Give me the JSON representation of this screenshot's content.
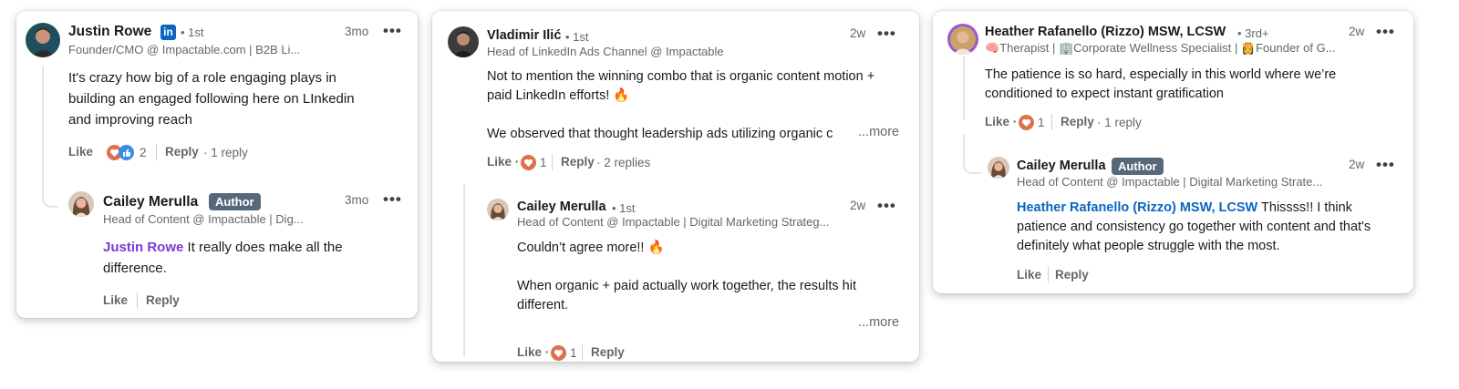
{
  "cards": [
    {
      "comment": {
        "name": "Justin Rowe",
        "degree": "• 1st",
        "headline": "Founder/CMO @ Impactable.com | B2B Li...",
        "time": "3mo",
        "body": [
          "It's crazy how big of a role engaging plays in",
          "building an engaged following here on LInkedin",
          "and improving reach"
        ],
        "like": "Like",
        "reaction_count": "2",
        "reply": "Reply",
        "replies": "· 1 reply"
      },
      "reply": {
        "name": "Cailey Merulla",
        "badge": "Author",
        "headline": "Head of Content @ Impactable | Dig...",
        "time": "3mo",
        "mention": "Justin Rowe",
        "body_after_mention": " It really does make all the",
        "body_line2": "difference.",
        "like": "Like",
        "reply": "Reply"
      }
    },
    {
      "comment": {
        "name": "Vladimir Ilić",
        "degree": "• 1st",
        "headline": "Head of LinkedIn Ads Channel @ Impactable",
        "time": "2w",
        "body": [
          "Not to mention the winning combo that is organic content motion +",
          "paid LinkedIn efforts! 🔥",
          "We observed that thought leadership ads utilizing organic c"
        ],
        "see_more": "...more",
        "like": "Like ·",
        "reaction_count": "1",
        "reply": "Reply",
        "replies": "· 2 replies"
      },
      "reply": {
        "name": "Cailey Merulla",
        "degree": "• 1st",
        "headline": "Head of Content @ Impactable | Digital Marketing Strateg...",
        "time": "2w",
        "body": [
          "Couldn’t agree more!! 🔥",
          "When organic + paid actually work together, the results hit",
          "different."
        ],
        "see_more": "...more",
        "like": "Like ·",
        "reaction_count": "1",
        "reply": "Reply"
      }
    },
    {
      "comment": {
        "name": "Heather Rafanello (Rizzo) MSW, LCSW",
        "degree": "• 3rd+",
        "headline": "🧠Therapist | 🏢Corporate Wellness Specialist | 👸Founder of G...",
        "time": "2w",
        "body": [
          "The patience is so hard, especially in this world where we’re",
          "conditioned to expect instant gratification"
        ],
        "like": "Like ·",
        "reaction_count": "1",
        "reply": "Reply",
        "replies": "· 1 reply"
      },
      "reply": {
        "name": "Cailey Merulla",
        "badge": "Author",
        "headline": "Head of Content @ Impactable | Digital Marketing Strate...",
        "time": "2w",
        "mention": "Heather Rafanello (Rizzo) MSW, LCSW",
        "body_after_mention": " Thissss!! I think",
        "body_line2": "patience and consistency go together with content and that's",
        "body_line3": "definitely what people struggle with the most.",
        "like": "Like",
        "reply": "Reply"
      }
    }
  ],
  "icons": {
    "linkedin_badge": "in",
    "more_menu": "•••"
  },
  "colors": {
    "author_badge": "#56687a",
    "mention_purple": "#7a3bd4",
    "mention_blue": "#0a66c2",
    "linkedin_blue": "#0a66c2"
  }
}
